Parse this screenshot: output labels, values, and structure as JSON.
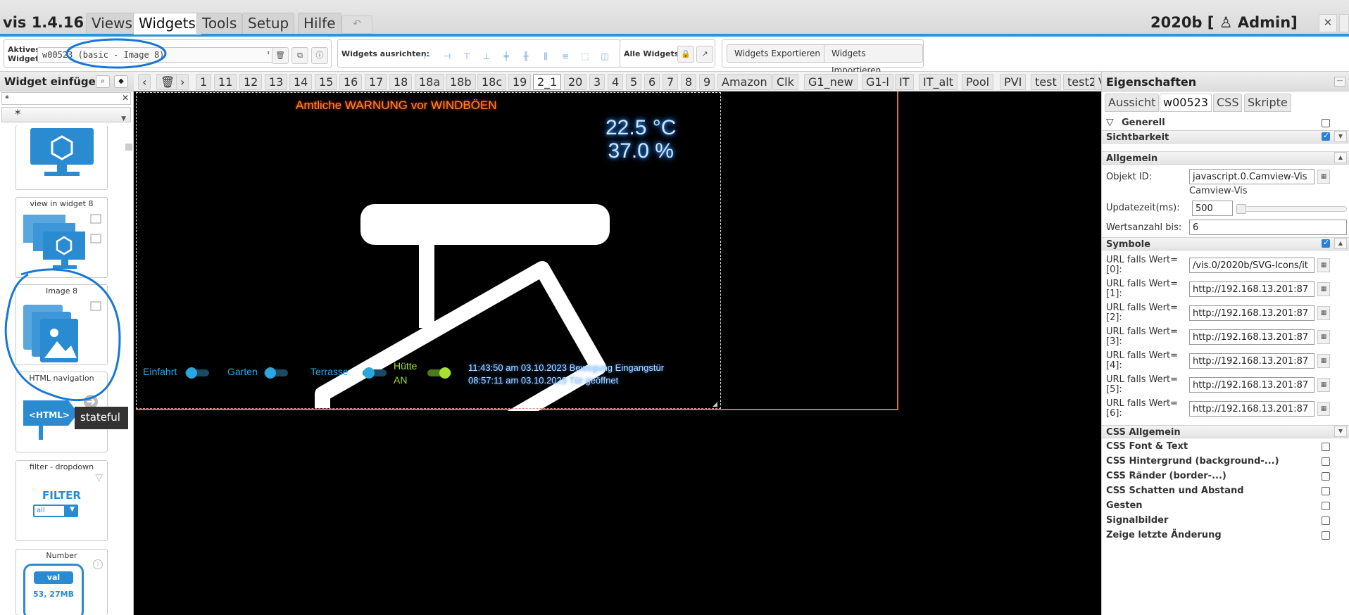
{
  "app": {
    "title": "vis 1.4.16",
    "project": "2020b [ ♙ Admin]"
  },
  "menu": {
    "tabs": [
      "Views",
      "Widgets",
      "Tools",
      "Setup",
      "Hilfe"
    ],
    "active": "Widgets",
    "undo": "↶"
  },
  "toolbar": {
    "active_widget_label_1": "Aktives",
    "active_widget_label_2": "Widget:",
    "active_widget_value": "w00523 (basic - Image 8)",
    "align_label": "Widgets ausrichten:",
    "all_label": "Alle Widgets:",
    "export_label": "Widgets Exportieren",
    "import_label": "Widgets Importieren"
  },
  "palette": {
    "title": "Widget einfügen",
    "filter_value": "*",
    "set_value": "*",
    "cards": [
      "view in widget 8",
      "Image 8",
      "HTML navigation",
      "filter - dropdown",
      "Number"
    ],
    "tooltip": "stateful",
    "html_badge": "<HTML>",
    "filter_text": "FILTER",
    "filter_option": "all",
    "number_val": "val",
    "number_size": "53, 27MB"
  },
  "views": {
    "tabs": [
      "‹",
      "🗑",
      "›",
      "1",
      "11",
      "12",
      "13",
      "14",
      "15",
      "16",
      "17",
      "18",
      "18a",
      "18b",
      "18c",
      "19",
      "2_1",
      "20",
      "3",
      "4",
      "5",
      "6",
      "7",
      "8",
      "9",
      "Amazon",
      "Clk",
      "G1_new",
      "G1-l",
      "IT",
      "IT_alt",
      "Pool",
      "PVI",
      "test",
      "test2",
      "V"
    ],
    "active": "2_1"
  },
  "canvas": {
    "warning": "Amtliche WARNUNG vor WINDBÖEN",
    "temperature": "22.5 °C",
    "humidity": "37.0 %",
    "switches": [
      "Einfahrt",
      "Garten",
      "Terrasse"
    ],
    "huette_line1": "Hütte",
    "huette_line2": "AN",
    "ticker_line1": "11:43:50 am 03.10.2023 Bewegung Eingangstür",
    "ticker_line2": "08:57:11 am 03.10.2023 Tür geöffnet"
  },
  "properties": {
    "title": "Eigenschaften",
    "tabs": [
      "Aussicht",
      "w00523",
      "CSS",
      "Skripte"
    ],
    "active_tab": "w00523",
    "generell": "Generell",
    "sichtbarkeit": "Sichtbarkeit",
    "allgemein": "Allgemein",
    "objekt_id_label": "Objekt ID:",
    "objekt_id_value": "javascript.0.Camview-Vis",
    "objekt_id_hint": "Camview-Vis",
    "update_label": "Updatezeit(ms):",
    "update_value": "500",
    "werts_label": "Wertsanzahl bis:",
    "werts_value": "6",
    "symbole": "Symbole",
    "urls": [
      {
        "label1": "URL falls Wert=",
        "label2": "[0]:",
        "value": "/vis.0/2020b/SVG-Icons/it"
      },
      {
        "label1": "URL falls Wert=",
        "label2": "[1]:",
        "value": "http://192.168.13.201:87"
      },
      {
        "label1": "URL falls Wert=",
        "label2": "[2]:",
        "value": "http://192.168.13.201:87"
      },
      {
        "label1": "URL falls Wert=",
        "label2": "[3]:",
        "value": "http://192.168.13.201:87"
      },
      {
        "label1": "URL falls Wert=",
        "label2": "[4]:",
        "value": "http://192.168.13.201:87"
      },
      {
        "label1": "URL falls Wert=",
        "label2": "[5]:",
        "value": "http://192.168.13.201:87"
      },
      {
        "label1": "URL falls Wert=",
        "label2": "[6]:",
        "value": "http://192.168.13.201:87"
      }
    ],
    "css_allgemein": "CSS Allgemein",
    "css_sections": [
      "CSS Font & Text",
      "CSS Hintergrund (background-...)",
      "CSS Ränder (border-...)",
      "CSS Schatten und Abstand",
      "Gesten",
      "Signalbilder",
      "Zeige letzte Änderung"
    ]
  },
  "colors": {
    "accent": "#2a95d8",
    "warning": "#ff8a2a",
    "glow_blue": "#3a9bff",
    "view_border": "#d0782a",
    "huette_green": "#a6e22e"
  }
}
